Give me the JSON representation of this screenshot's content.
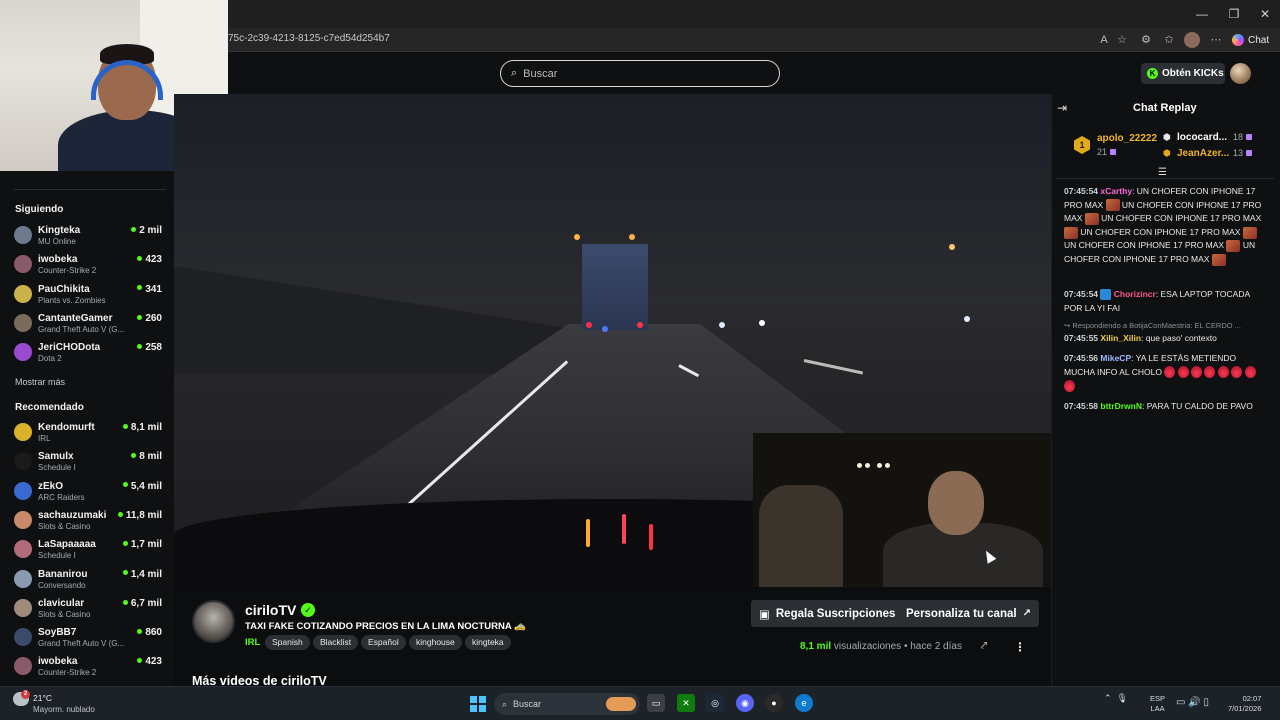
{
  "browser": {
    "url": "75c-2c39-4213-8125-c7ed54d254b7",
    "chat_label": "Chat"
  },
  "header": {
    "search_placeholder": "Buscar",
    "kicks_label": "Obtén KICKs"
  },
  "sidebar": {
    "following_title": "Siguiendo",
    "following": [
      {
        "name": "Kingteka",
        "game": "MU Online",
        "viewers": "2 mil",
        "color": "#6b7a8f"
      },
      {
        "name": "iwobeka",
        "game": "Counter-Strike 2",
        "viewers": "423",
        "color": "#8a5a6b"
      },
      {
        "name": "PauChikita",
        "game": "Plants vs. Zombies",
        "viewers": "341",
        "color": "#c9b24a"
      },
      {
        "name": "CantanteGamer",
        "game": "Grand Theft Auto V (G...",
        "viewers": "260",
        "color": "#7a6b5a"
      },
      {
        "name": "JeriCHODota",
        "game": "Dota 2",
        "viewers": "258",
        "color": "#9b4ad0"
      }
    ],
    "show_more": "Mostrar más",
    "recommended_title": "Recomendado",
    "recommended": [
      {
        "name": "Kendomurft",
        "game": "IRL",
        "viewers": "8,1 mil",
        "color": "#d9b22a"
      },
      {
        "name": "Samulx",
        "game": "Schedule I",
        "viewers": "8 mil",
        "color": "#1a1a1a"
      },
      {
        "name": "zEkO",
        "game": "ARC Raiders",
        "viewers": "5,4 mil",
        "color": "#3a6ad0"
      },
      {
        "name": "sachauzumaki",
        "game": "Slots & Casino",
        "viewers": "11,8 mil",
        "color": "#c98a6a"
      },
      {
        "name": "LaSapaaaaa",
        "game": "Schedule I",
        "viewers": "1,7 mil",
        "color": "#b06a7a"
      },
      {
        "name": "Bananirou",
        "game": "Conversando",
        "viewers": "1,4 mil",
        "color": "#8a9ab0"
      },
      {
        "name": "clavicular",
        "game": "Slots & Casino",
        "viewers": "6,7 mil",
        "color": "#a08a7a"
      },
      {
        "name": "SoyBB7",
        "game": "Grand Theft Auto V (G...",
        "viewers": "860",
        "color": "#3a4a6a"
      },
      {
        "name": "iwobeka",
        "game": "Counter-Strike 2",
        "viewers": "423",
        "color": "#8a5a6b"
      }
    ]
  },
  "stream": {
    "streamer": "ciriloTV",
    "title": "TAXI FAKE COTIZANDO PRECIOS EN LA LIMA NOCTURNA 🚕",
    "category": "IRL",
    "tags": [
      "Spanish",
      "Blacklist",
      "Español",
      "kinghouse",
      "kingteka"
    ],
    "gift_button": "Regala Suscripciones",
    "customize_button": "Personaliza tu canal",
    "views_count": "8,1 mil",
    "views_label": "visualizaciones",
    "posted": "hace 2 días",
    "more_videos": "Más videos de ciriloTV"
  },
  "chat": {
    "title": "Chat Replay",
    "leaderboard": [
      {
        "rank": "1",
        "name": "apolo_22222",
        "count": "21",
        "color": "#f0b429"
      },
      {
        "name": "lococard...",
        "count": "18",
        "color": "#ffffff"
      },
      {
        "name": "JeanAzer...",
        "count": "13",
        "color": "#f0b429"
      }
    ],
    "messages": [
      {
        "ts": "07:45:54",
        "user": "xCarthy",
        "color": "#ff6bd6",
        "text": "UN CHOFER CON IPHONE 17 PRO MAX ▮ UN CHOFER CON IPHONE 17 PRO MAX ▮ UN CHOFER CON IPHONE 17 PRO MAX ▮ UN CHOFER CON IPHONE 17 PRO MAX ▮ UN CHOFER CON IPHONE 17 PRO MAX ▮ UN CHOFER CON IPHONE 17 PRO MAX ▮"
      },
      {
        "ts": "07:45:54",
        "user": "Chorizincr",
        "color": "#ff5a8a",
        "text": "ESA LAPTOP TOCADA POR LA YI FAI"
      },
      {
        "reply": "Respondiendo a BotijaConMaestria: EL CERDO ..."
      },
      {
        "ts": "07:45:55",
        "user": "Xilin_Xilin",
        "color": "#f0d050",
        "text": "que paso' contexto"
      },
      {
        "ts": "07:45:56",
        "user": "MikeCP",
        "color": "#9ab8ff",
        "text": "YA LE ESTÁS METIENDO MUCHA INFO AL CHOLO"
      },
      {
        "ts": "07:45:58",
        "user": "bttrDrwnN",
        "color": "#53fc18",
        "text": "PARA TU CALDO DE PAVO"
      }
    ]
  },
  "taskbar": {
    "temp": "21°C",
    "weather": "Mayorm. nublado",
    "weather_badge": "2",
    "search_label": "Buscar",
    "lang_top": "ESP",
    "lang_bottom": "LAA",
    "time": "02:07",
    "date": "7/01/2026"
  }
}
